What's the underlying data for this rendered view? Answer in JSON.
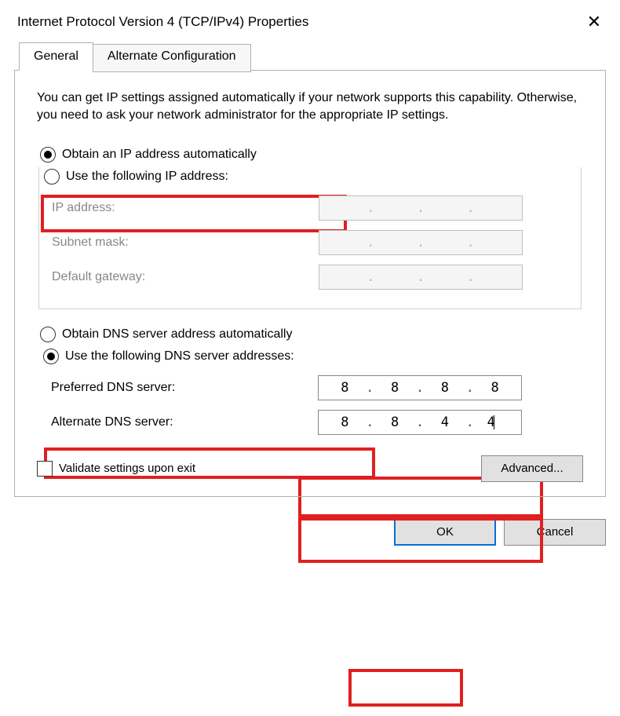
{
  "window": {
    "title": "Internet Protocol Version 4 (TCP/IPv4) Properties"
  },
  "tabs": {
    "general": "General",
    "alternate": "Alternate Configuration",
    "active": "general"
  },
  "description": "You can get IP settings assigned automatically if your network supports this capability. Otherwise, you need to ask your network administrator for the appropriate IP settings.",
  "ip_section": {
    "radio_auto": "Obtain an IP address automatically",
    "radio_manual": "Use the following IP address:",
    "selected": "auto",
    "fields": {
      "ip_label": "IP address:",
      "subnet_label": "Subnet mask:",
      "gateway_label": "Default gateway:",
      "ip_value": [
        "",
        "",
        "",
        ""
      ],
      "subnet_value": [
        "",
        "",
        "",
        ""
      ],
      "gateway_value": [
        "",
        "",
        "",
        ""
      ]
    }
  },
  "dns_section": {
    "radio_auto": "Obtain DNS server address automatically",
    "radio_manual": "Use the following DNS server addresses:",
    "selected": "manual",
    "fields": {
      "preferred_label": "Preferred DNS server:",
      "alternate_label": "Alternate DNS server:",
      "preferred_value": [
        "8",
        "8",
        "8",
        "8"
      ],
      "alternate_value": [
        "8",
        "8",
        "4",
        "4"
      ]
    }
  },
  "validate_checkbox": {
    "label": "Validate settings upon exit",
    "checked": false
  },
  "buttons": {
    "advanced": "Advanced...",
    "ok": "OK",
    "cancel": "Cancel"
  }
}
